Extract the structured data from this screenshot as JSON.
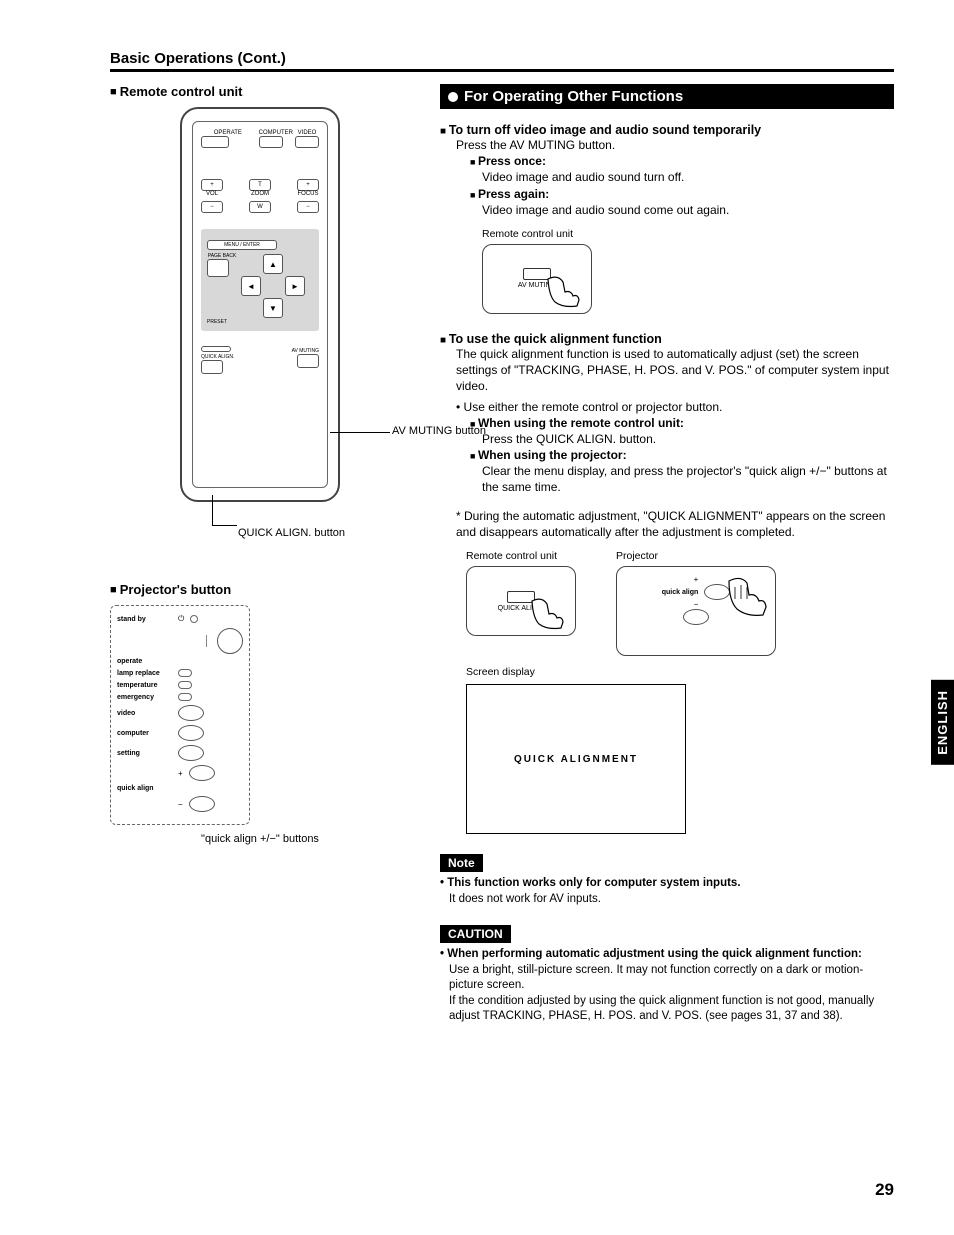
{
  "header": {
    "title": "Basic Operations (Cont.)"
  },
  "left": {
    "remote_heading": "Remote control unit",
    "remote_labels": {
      "operate": "OPERATE",
      "computer": "COMPUTER",
      "video": "VIDEO",
      "vol": "VOL",
      "zoom": "ZOOM",
      "focus": "FOCUS",
      "t": "T",
      "w": "W",
      "menu_enter": "MENU / ENTER",
      "page_back": "PAGE BACK",
      "preset": "PRESET",
      "quick_align": "QUICK ALIGN.",
      "av_muting": "AV MUTING"
    },
    "callout_av": "AV MUTING button",
    "callout_qa": "QUICK ALIGN. button",
    "projector_heading": "Projector's button",
    "proj_labels": {
      "standby": "stand by",
      "operate": "operate",
      "lamp": "lamp replace",
      "temp": "temperature",
      "emergency": "emergency",
      "video": "video",
      "computer": "computer",
      "setting": "setting",
      "quick_align": "quick align",
      "plus": "+",
      "minus": "−"
    },
    "proj_callout": "\"quick align +/−\" buttons"
  },
  "right": {
    "bar_title": "For Operating Other Functions",
    "sec1": {
      "heading": "To turn off video image and audio sound temporarily",
      "line1": "Press the AV MUTING button.",
      "press_once": "Press once:",
      "press_once_body": "Video image and audio sound turn off.",
      "press_again": "Press again:",
      "press_again_body": "Video image and audio sound come out again.",
      "fig_label": "Remote control unit",
      "fig_btn": "AV MUTING"
    },
    "sec2": {
      "heading": "To use the quick alignment function",
      "body1": "The quick alignment function is used to automatically adjust (set) the screen settings of \"TRACKING, PHASE, H. POS. and V. POS.\" of computer system input video.",
      "bullet1": "Use either the remote control or projector button.",
      "sub1": "When using the remote control unit:",
      "sub1_body": "Press the QUICK ALIGN. button.",
      "sub2": "When using the projector:",
      "sub2_body": "Clear the menu display, and press the projector's \"quick align +/−\" buttons at the same time.",
      "star_body": "* During the automatic adjustment, \"QUICK ALIGNMENT\" appears on the screen and disappears automatically after the adjustment is completed.",
      "fig_remote": "Remote control unit",
      "fig_projector": "Projector",
      "fig_remote_btn": "QUICK ALIGN.",
      "fig_proj_btn": "quick align",
      "screen_label": "Screen display",
      "screen_text": "QUICK ALIGNMENT"
    },
    "note": {
      "tag": "Note",
      "line1": "This function works only for computer system inputs.",
      "line2": "It does not work for AV inputs."
    },
    "caution": {
      "tag": "CAUTION",
      "heading": "When performing automatic adjustment using the quick alignment function:",
      "body1": "Use a bright, still-picture screen. It may not function correctly on a dark or motion-picture screen.",
      "body2": "If the condition adjusted by using the quick alignment function is not good, manually adjust TRACKING, PHASE, H. POS. and V. POS. (see pages 31, 37 and 38)."
    }
  },
  "lang_tab": "ENGLISH",
  "page_number": "29"
}
